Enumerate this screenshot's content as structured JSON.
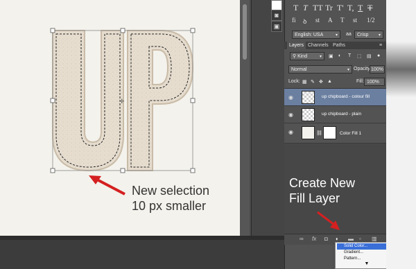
{
  "canvas": {
    "letters": "UP",
    "callout_line1": "New selection",
    "callout_line2": "10 px smaller"
  },
  "char_panel": {
    "glyphs": [
      "T",
      "T",
      "TT",
      "Tr",
      "T'",
      "T,",
      "T",
      "T"
    ],
    "language": "English: USA",
    "antialias_icon": "aa",
    "antialias": "Crisp",
    "fraction": "1/2",
    "superscript": "st"
  },
  "layers_panel": {
    "tabs": [
      "Layers",
      "Channels",
      "Paths"
    ],
    "kind_filter": "Kind",
    "blend_mode": "Normal",
    "opacity_label": "Opacity:",
    "opacity_value": "100%",
    "lock_label": "Lock:",
    "fill_label": "Fill:",
    "fill_value": "100%",
    "layers": [
      {
        "name": "up chipboard - colour fill",
        "selected": true
      },
      {
        "name": "up chipboard - plain",
        "selected": false
      },
      {
        "name": "Color Fill 1",
        "selected": false
      }
    ]
  },
  "annotation": {
    "line1": "Create New",
    "line2": "Fill Layer"
  },
  "fill_menu": {
    "items": [
      "Solid Color...",
      "Gradient...",
      "Pattern..."
    ]
  },
  "colors": {
    "arrow": "#d42020",
    "selected_layer": "#6b7fa0",
    "menu_highlight": "#3a6fd8"
  }
}
